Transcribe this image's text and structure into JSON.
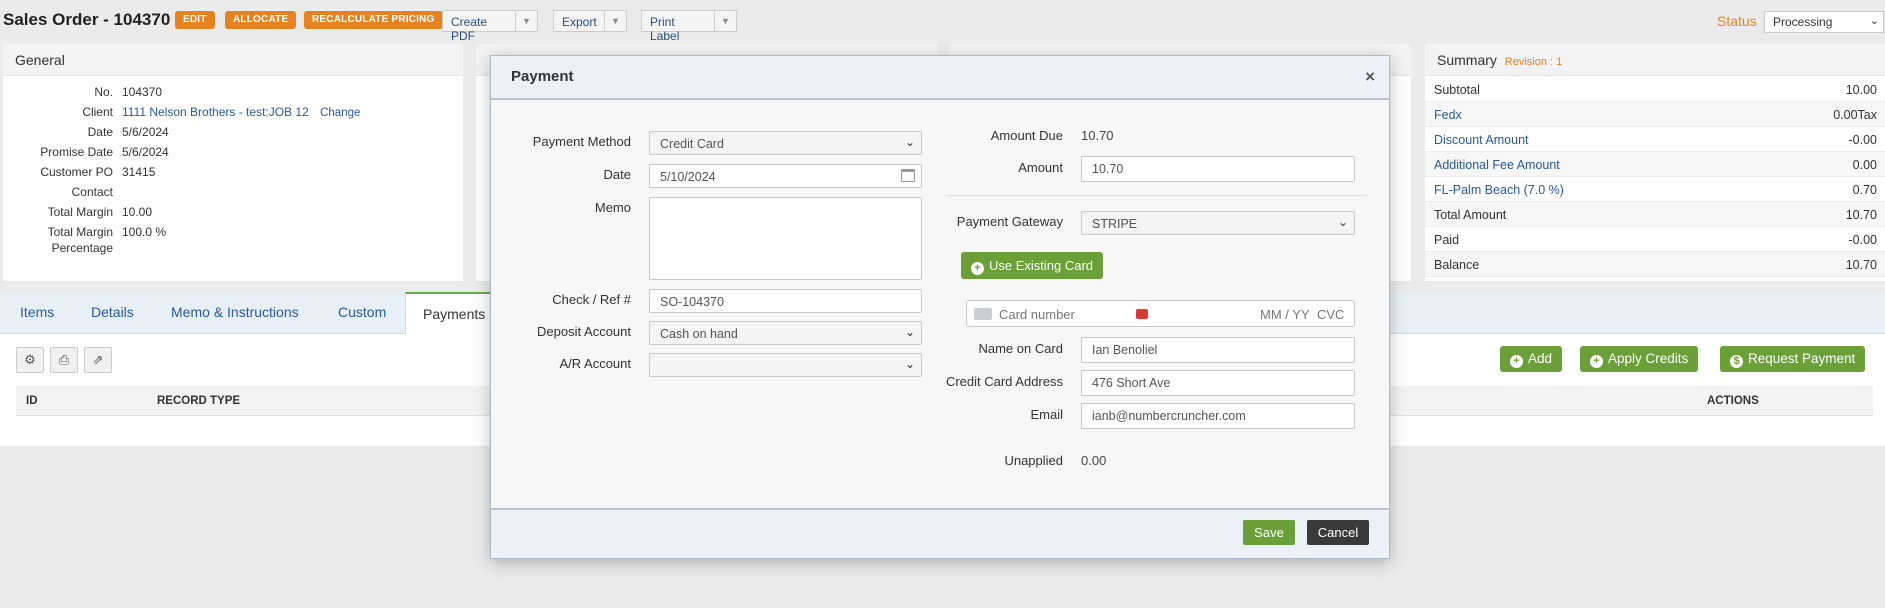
{
  "header": {
    "title": "Sales Order - 104370",
    "edit_label": "EDIT",
    "allocate_label": "ALLOCATE",
    "recalc_label": "RECALCULATE PRICING",
    "create_pdf_label": "Create PDF",
    "export_label": "Export",
    "print_label": "Print Label",
    "status_label": "Status",
    "status_value": "Processing"
  },
  "general": {
    "heading": "General",
    "rows": [
      {
        "label": "No.",
        "value": "104370"
      },
      {
        "label": "Client",
        "value": "1111 Nelson Brothers - test:JOB 12",
        "action": "Change"
      },
      {
        "label": "Date",
        "value": "5/6/2024"
      },
      {
        "label": "Promise Date",
        "value": "5/6/2024"
      },
      {
        "label": "Customer PO",
        "value": "31415"
      },
      {
        "label": "Contact",
        "value": ""
      },
      {
        "label": "Total Margin",
        "value": "10.00"
      },
      {
        "label": "Total Margin",
        "label2": "Percentage",
        "value": "100.0 %"
      }
    ]
  },
  "summary": {
    "heading": "Summary",
    "revision": "Revision : 1",
    "rows": [
      {
        "label": "Subtotal",
        "value": "10.00"
      },
      {
        "label": "Fedx",
        "value": "0.00Tax"
      },
      {
        "label": "Discount Amount",
        "value": "-0.00"
      },
      {
        "label": "Additional Fee Amount",
        "value": "0.00"
      },
      {
        "label": "FL-Palm Beach (7.0 %)",
        "value": "0.70"
      },
      {
        "label": "Total Amount",
        "value": "10.70"
      },
      {
        "label": "Paid",
        "value": "-0.00"
      },
      {
        "label": "Balance",
        "value": "10.70"
      }
    ]
  },
  "tabs": [
    {
      "label": "Items"
    },
    {
      "label": "Details"
    },
    {
      "label": "Memo & Instructions"
    },
    {
      "label": "Custom"
    },
    {
      "label": "Payments"
    }
  ],
  "payments_panel": {
    "add_label": "Add",
    "apply_credits_label": "Apply Credits",
    "request_payment_label": "Request Payment",
    "columns": [
      "ID",
      "RECORD TYPE",
      "ACTIONS"
    ]
  },
  "modal": {
    "title": "Payment",
    "close": "×",
    "payment_method_label": "Payment Method",
    "payment_method_value": "Credit Card",
    "date_label": "Date",
    "date_value": "5/10/2024",
    "memo_label": "Memo",
    "check_ref_label": "Check / Ref #",
    "check_ref_value": "SO-104370",
    "deposit_account_label": "Deposit Account",
    "deposit_account_value": "Cash on hand",
    "ar_account_label": "A/R Account",
    "ar_account_value": "",
    "amount_due_label": "Amount Due",
    "amount_due_value": "10.70",
    "amount_label": "Amount",
    "amount_value": "10.70",
    "gateway_label": "Payment Gateway",
    "gateway_value": "STRIPE",
    "use_existing_card_label": "Use Existing Card",
    "card_number_placeholder": "Card number",
    "card_exp_placeholder": "MM / YY",
    "card_cvc_placeholder": "CVC",
    "name_on_card_label": "Name on Card",
    "name_on_card_value": "Ian Benoliel",
    "cc_address_label": "Credit Card Address",
    "cc_address_value": "476 Short Ave",
    "email_label": "Email",
    "email_value": "ianb@numbercruncher.com",
    "unapplied_label": "Unapplied",
    "unapplied_value": "0.00",
    "save_label": "Save",
    "cancel_label": "Cancel"
  },
  "colors": {
    "accent_orange": "#e6821f",
    "accent_green": "#6aa037",
    "link_blue": "#2a5a9a"
  }
}
